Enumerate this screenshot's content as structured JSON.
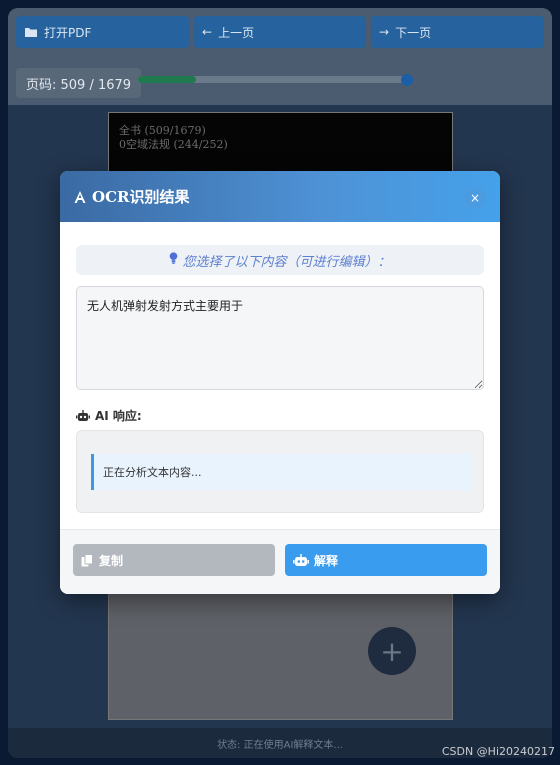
{
  "toolbar": {
    "open_pdf": "打开PDF",
    "prev_page": "上一页",
    "next_page": "下一页"
  },
  "pagination": {
    "label": "页码: 509 / 1679",
    "progress": 0.215
  },
  "document": {
    "line1": "全书 (509/1679)",
    "line2": "0空域法规 (244/252)"
  },
  "modal": {
    "title": "OCR识别结果",
    "close": "×",
    "hint": "您选择了以下内容（可进行编辑）：",
    "ocr_text": "无人机弹射发射方式主要用于",
    "ai_label": "AI 响应:",
    "ai_status": "正在分析文本内容...",
    "copy_label": "复制",
    "explain_label": "解释"
  },
  "status": {
    "text": "状态: 正在使用AI解释文本..."
  },
  "watermark": "CSDN @Hi20240217",
  "colors": {
    "accent": "#3a9cef",
    "header_start": "#3b6aa3",
    "header_end": "#45a1ea",
    "disabled": "#b3b8be"
  },
  "icons": {
    "open": "folder-open-icon",
    "prev": "arrow-left-icon",
    "next": "arrow-right-icon",
    "title": "font-icon",
    "hint": "lightbulb-icon",
    "ai": "robot-icon",
    "copy": "copy-icon",
    "explain": "robot-icon",
    "fab": "plus-icon"
  }
}
